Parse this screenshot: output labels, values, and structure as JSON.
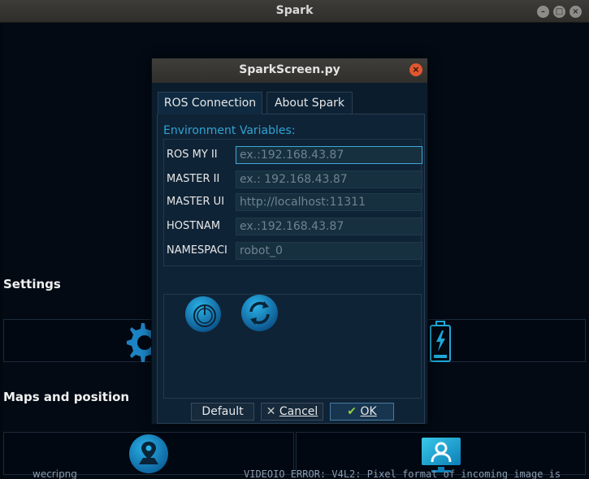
{
  "window": {
    "title": "Spark"
  },
  "sections": {
    "settings": "Settings",
    "maps": "Maps and position"
  },
  "background_text": {
    "left": "wecripng",
    "right": "VIDEOIO ERROR: V4L2: Pixel format of incoming image is"
  },
  "dialog": {
    "title": "SparkScreen.py",
    "tabs": [
      {
        "label": "ROS Connection",
        "active": true
      },
      {
        "label": "About Spark",
        "active": false
      }
    ],
    "env_label": "Environment Variables:",
    "fields": [
      {
        "label": "ROS_MY_IP",
        "visible_label": "ROS  MY  II",
        "placeholder": "ex.:192.168.43.87",
        "focused": true
      },
      {
        "label": "MASTER_IP",
        "visible_label": "MASTER  II",
        "placeholder": "ex.: 192.168.43.87",
        "focused": false
      },
      {
        "label": "MASTER_URI",
        "visible_label": "MASTER  UI",
        "placeholder": "http://localhost:11311",
        "focused": false
      },
      {
        "label": "HOSTNAME",
        "visible_label": "HOSTNAM",
        "placeholder": "ex.:192.168.43.87",
        "focused": false
      },
      {
        "label": "NAMESPACE",
        "visible_label": "NAMESPACI",
        "placeholder": "robot_0",
        "focused": false
      }
    ],
    "buttons": {
      "default": "Default",
      "cancel": "Cancel",
      "ok": "OK"
    }
  },
  "colors": {
    "accent": "#2fa4d4",
    "close": "#e0572f",
    "background": "#030a14",
    "ok_check": "#8ed23c",
    "cancel_x": "#c8c8c8"
  }
}
